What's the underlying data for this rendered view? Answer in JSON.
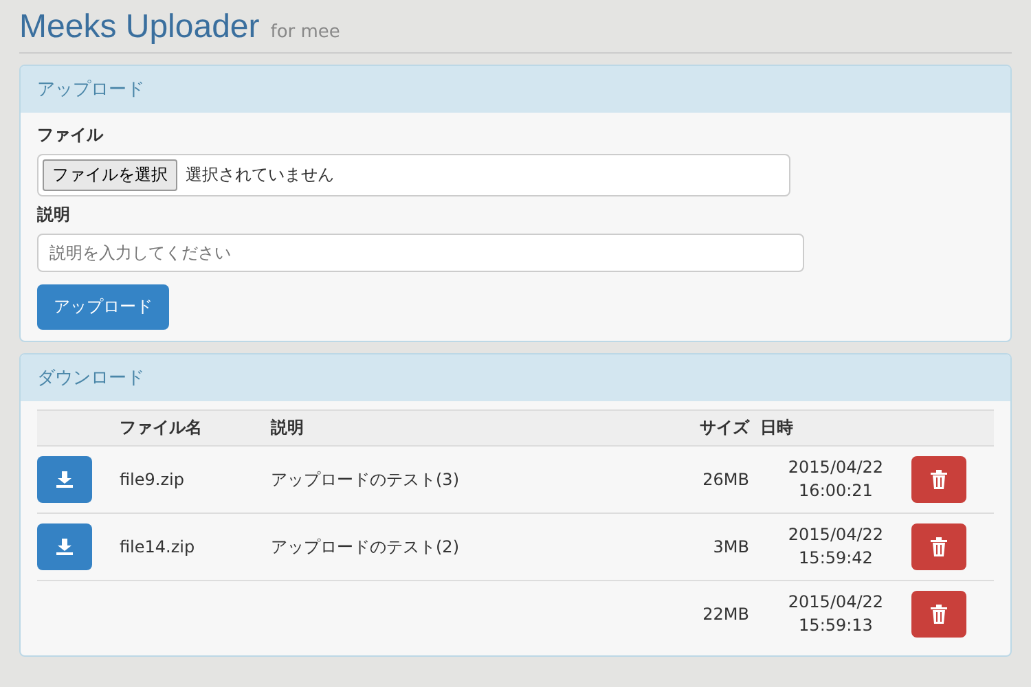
{
  "header": {
    "title": "Meeks Uploader",
    "subtitle": "for mee"
  },
  "upload_panel": {
    "heading": "アップロード",
    "file_label": "ファイル",
    "file_button": "ファイルを選択",
    "file_status": "選択されていません",
    "description_label": "説明",
    "description_placeholder": "説明を入力してください",
    "submit": "アップロード"
  },
  "download_panel": {
    "heading": "ダウンロード",
    "columns": [
      "ファイル名",
      "説明",
      "サイズ",
      "日時"
    ],
    "rows": [
      {
        "file": "file9.zip",
        "description": "アップロードのテスト(3)",
        "size": "26MB",
        "date": "2015/04/22",
        "time": "16:00:21"
      },
      {
        "file": "file14.zip",
        "description": "アップロードのテスト(2)",
        "size": "3MB",
        "date": "2015/04/22",
        "time": "15:59:42"
      },
      {
        "size": "22MB",
        "date": "2015/04/22",
        "time": "15:59:13"
      }
    ]
  }
}
